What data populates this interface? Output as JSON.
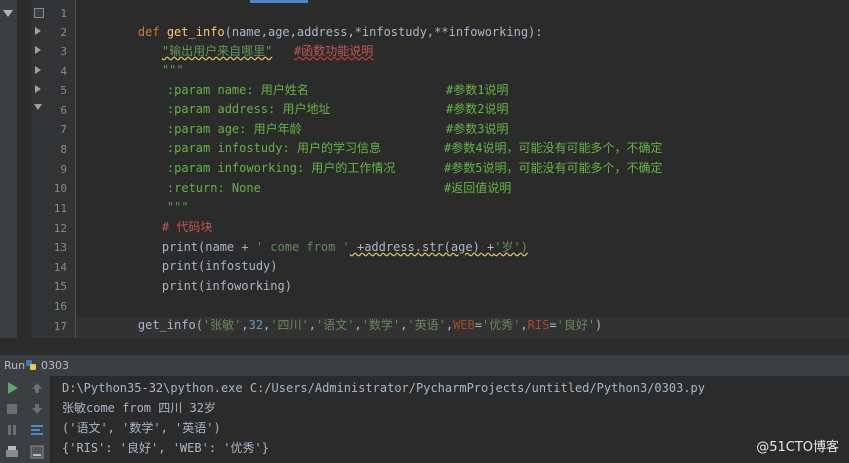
{
  "editor": {
    "line_numbers": [
      "1",
      "2",
      "3",
      "4",
      "5",
      "6",
      "7",
      "8",
      "9",
      "10",
      "11",
      "12",
      "13",
      "14",
      "15",
      "16",
      "17"
    ],
    "line1": {
      "kw": "def",
      "fn": "get_info",
      "params": "(name,age,address,*infostudy,**infoworking):"
    },
    "line2": {
      "doc": "\"输出用户来自哪里\"",
      "cmt": "#函数功能说明"
    },
    "line3": {
      "doc": "\"\"\""
    },
    "line4": {
      "left": ":param name: 用户姓名",
      "right": "#参数1说明"
    },
    "line5": {
      "left": ":param address: 用户地址",
      "right": "#参数2说明"
    },
    "line6": {
      "left": ":param age: 用户年龄",
      "right": "#参数3说明"
    },
    "line7": {
      "left": ":param infostudy: 用户的学习信息",
      "right": "#参数4说明，可能没有可能多个，不确定"
    },
    "line8": {
      "left": ":param infoworking: 用户的工作情况",
      "right": "#参数5说明，可能没有可能多个，不确定"
    },
    "line9": {
      "left": ":return: None",
      "right": "#返回值说明"
    },
    "line10": {
      "doc": "\"\"\""
    },
    "line11": {
      "cmt": "# 代码块"
    },
    "line12": {
      "p1": "print(name + ",
      "s1": "' come from '",
      "p2": " +address.str(age) +",
      "s2": "'岁')"
    },
    "line13": {
      "text": "print(infostudy)"
    },
    "line14": {
      "text": "print(infoworking)"
    },
    "line16": {
      "fn": "get_info(",
      "s1": "'张敏'",
      "c1": ",",
      "n1": "32",
      "c2": ",",
      "s2": "'四川'",
      "c3": ",",
      "s3": "'语文'",
      "c4": ",",
      "s4": "'数学'",
      "c5": ",",
      "s5": "'英语'",
      "c6": ",",
      "k1": "WEB",
      "eq1": "=",
      "s6": "'优秀'",
      "c7": ",",
      "k2": "RIS",
      "eq2": "=",
      "s7": "'良好'",
      "close": ")"
    }
  },
  "run": {
    "label": "Run",
    "config": "0303",
    "console_lines": [
      "D:\\Python35-32\\python.exe C:/Users/Administrator/PycharmProjects/untitled/Python3/0303.py",
      "张敏come from 四川 32岁",
      "('语文', '数学', '英语')",
      "{'RIS': '良好', 'WEB': '优秀'}"
    ]
  },
  "watermark": "@51CTO博客",
  "colors": {
    "accent": "#4a88c7",
    "keyword": "#cc7832",
    "string": "#6a8759",
    "doc": "#629755",
    "comment": "#808080"
  }
}
